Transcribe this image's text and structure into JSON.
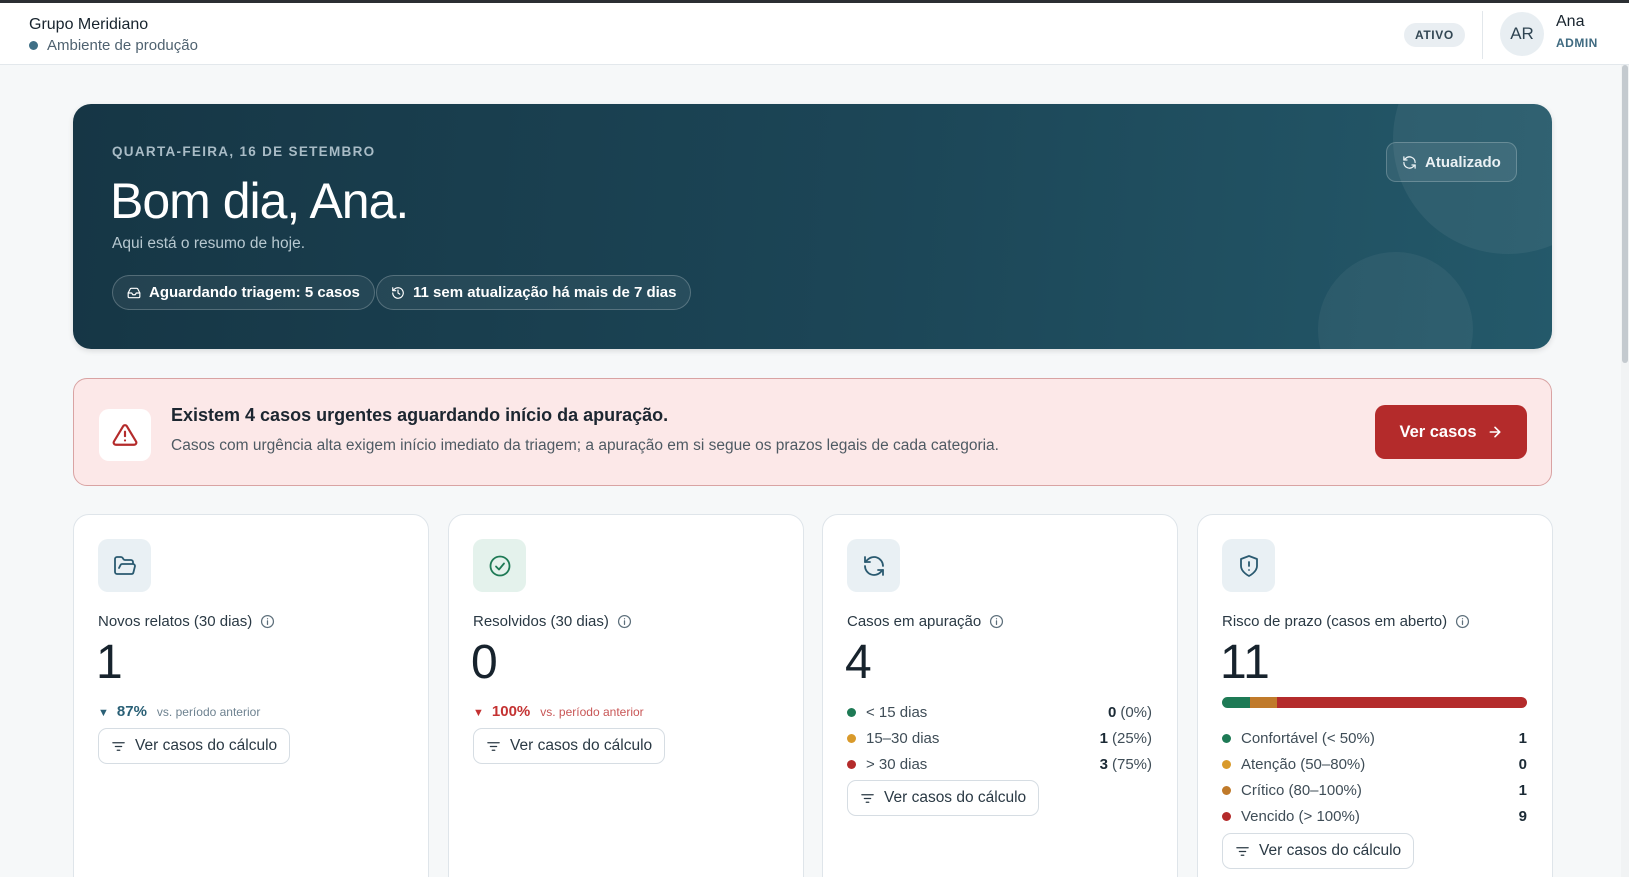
{
  "header": {
    "org_name": "Grupo Meridiano",
    "environment": "Ambiente de produção",
    "status": "ATIVO",
    "user_initials": "AR",
    "user_name": "Ana",
    "user_role": "ADMIN"
  },
  "hero": {
    "date": "QUARTA-FEIRA, 16 DE SETEMBRO",
    "greeting": "Bom dia, Ana.",
    "summary": "Aqui está o resumo de hoje.",
    "chips": [
      {
        "icon": "inbox-icon",
        "label": "Aguardando triagem: 5 casos"
      },
      {
        "icon": "history-icon",
        "label": "11 sem atualização há mais de 7 dias"
      }
    ],
    "refresh_label": "Atualizado"
  },
  "alert": {
    "title": "Existem 4 casos urgentes aguardando início da apuração.",
    "description": "Casos com urgência alta exigem início imediato da triagem; a apuração em si segue os prazos legais de cada categoria.",
    "button_label": "Ver casos"
  },
  "cards": [
    {
      "icon": "folder-open-icon",
      "title": "Novos relatos (30 dias)",
      "value": "1",
      "trend": {
        "direction": "down",
        "percent": "87%",
        "comparison": "vs. período anterior",
        "color": "#2a6076"
      },
      "button_label": "Ver casos do cálculo"
    },
    {
      "icon": "check-circle-icon",
      "title": "Resolvidos (30 dias)",
      "value": "0",
      "trend": {
        "direction": "down",
        "percent": "100%",
        "comparison": "vs. período anterior",
        "color": "#c43232"
      },
      "button_label": "Ver casos do cálculo"
    },
    {
      "icon": "refresh-cycle-icon",
      "title": "Casos em apuração",
      "value": "4",
      "breakdown": [
        {
          "label": "< 15 dias",
          "count": "0",
          "percent": "(0%)",
          "color": "#1e7a55"
        },
        {
          "label": "15–30 dias",
          "count": "1",
          "percent": "(25%)",
          "color": "#d99a2b"
        },
        {
          "label": "> 30 dias",
          "count": "3",
          "percent": "(75%)",
          "color": "#b42b2b"
        }
      ],
      "button_label": "Ver casos do cálculo"
    },
    {
      "icon": "shield-alert-icon",
      "title": "Risco de prazo (casos em aberto)",
      "value": "11",
      "risk_bar": [
        {
          "fraction": 0.0909,
          "color": "#1e7a55"
        },
        {
          "fraction": 0.0,
          "color": "#d99a2b"
        },
        {
          "fraction": 0.0909,
          "color": "#c07a2a"
        },
        {
          "fraction": 0.8182,
          "color": "#b42b2b"
        }
      ],
      "breakdown": [
        {
          "label": "Confortável (< 50%)",
          "count": "1",
          "color": "#1e7a55"
        },
        {
          "label": "Atenção (50–80%)",
          "count": "0",
          "color": "#d99a2b"
        },
        {
          "label": "Crítico (80–100%)",
          "count": "1",
          "color": "#c07a2a"
        },
        {
          "label": "Vencido (> 100%)",
          "count": "9",
          "color": "#b42b2b"
        }
      ],
      "button_label": "Ver casos do cálculo"
    }
  ]
}
